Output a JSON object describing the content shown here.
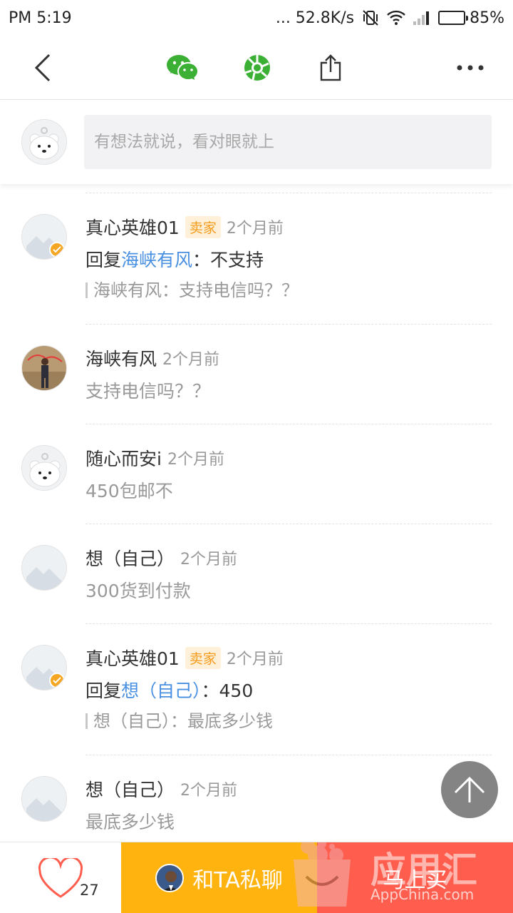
{
  "status": {
    "time": "PM 5:19",
    "net_speed": "... 52.8K/s",
    "battery": "85%",
    "battery_level": 0.85
  },
  "toolbar": {
    "back_icon": "chevron-left-icon",
    "wechat_icon": "wechat-icon",
    "moments_icon": "moments-icon",
    "share_icon": "share-icon",
    "more_icon": "more-icon"
  },
  "comment_box": {
    "placeholder": "有想法就说，看对眼就上"
  },
  "comments": [
    {
      "nick": "真心英雄01",
      "seller_tag": "卖家",
      "time": "2个月前",
      "reply_prefix": "回复",
      "reply_to": "海峡有风",
      "reply_text": "：不支持",
      "quote": "海峡有风：支持电信吗？？"
    },
    {
      "nick": "海峡有风",
      "time": "2个月前",
      "text": "支持电信吗？？"
    },
    {
      "nick": "随心而安i",
      "time": "2个月前",
      "text": "450包邮不"
    },
    {
      "nick": "想（自己）",
      "time": "2个月前",
      "text": "300货到付款"
    },
    {
      "nick": "真心英雄01",
      "seller_tag": "卖家",
      "time": "2个月前",
      "reply_prefix": "回复",
      "reply_to": "想（自己）",
      "reply_text": "：450",
      "quote": "想（自己）：最底多少钱"
    },
    {
      "nick": "想（自己）",
      "time": "2个月前",
      "text": "最底多少钱"
    }
  ],
  "bottom": {
    "like_count": "27",
    "chat_label": "和TA私聊",
    "buy_label": "马上买"
  },
  "watermark": {
    "brand": "应用汇",
    "site": "AppChina.com"
  },
  "colors": {
    "accent_yellow": "#ffb30f",
    "accent_red": "#ff5e4e",
    "link_blue": "#4a90e2",
    "seller_orange": "#f59b1b"
  }
}
